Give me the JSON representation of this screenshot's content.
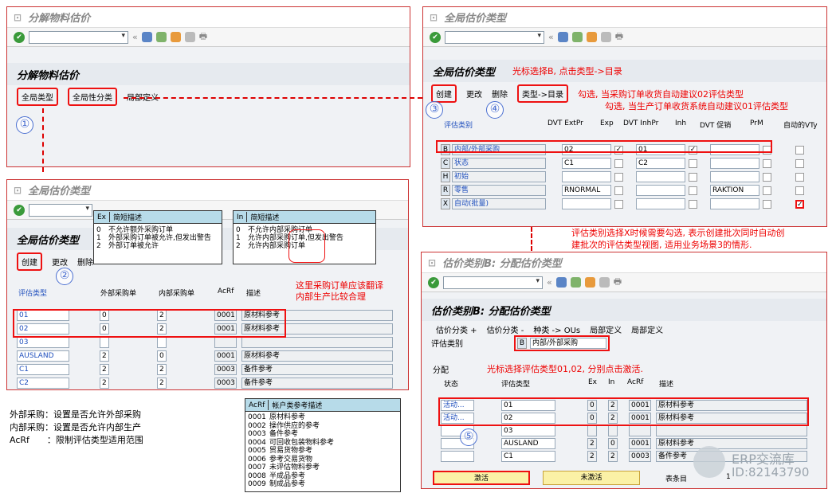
{
  "w1": {
    "title": "分解物料估价",
    "header": "分解物料估价",
    "btn1": "全局类型",
    "btn2": "全局性分类",
    "btn3": "局部定义",
    "n1": "①"
  },
  "w2": {
    "title": "全局估价类型",
    "header": "全局估价类型",
    "btns": [
      "创建",
      "更改",
      "删除"
    ],
    "n2": "②",
    "cols": {
      "vc": "评估类型",
      "ext": "外部采购单",
      "int": "内部采购单",
      "acrf": "AcRf",
      "desc": "描述"
    },
    "rows": [
      {
        "vc": "01",
        "ext": "0",
        "int": "2",
        "acrf": "0001",
        "desc": "原材料参考"
      },
      {
        "vc": "02",
        "ext": "0",
        "int": "2",
        "acrf": "0001",
        "desc": "原材料参考"
      },
      {
        "vc": "03",
        "ext": "",
        "int": "",
        "acrf": "",
        "desc": ""
      },
      {
        "vc": "AUSLAND",
        "ext": "2",
        "int": "0",
        "acrf": "0001",
        "desc": "原材料参考"
      },
      {
        "vc": "C1",
        "ext": "2",
        "int": "2",
        "acrf": "0003",
        "desc": "备件参考"
      },
      {
        "vc": "C2",
        "ext": "2",
        "int": "2",
        "acrf": "0003",
        "desc": "备件参考"
      }
    ],
    "note": "这里采购订单应该翻译\n内部生产比较合理"
  },
  "pop1": {
    "k": "Ex",
    "h": "简短描述",
    "rows": [
      [
        "0",
        "不允许额外采购订单"
      ],
      [
        "1",
        "外部采购订单被允许,但发出警告"
      ],
      [
        "2",
        "外部订单被允许"
      ]
    ]
  },
  "pop2": {
    "k": "In",
    "h": "简短描述",
    "rows": [
      [
        "0",
        "不允许内部采购订单"
      ],
      [
        "1",
        "允许内部采购订单,但发出警告"
      ],
      [
        "2",
        "允许内部采购订单"
      ]
    ]
  },
  "pop3": {
    "k": "AcRf",
    "h": "帐户类参考描述",
    "rows": [
      [
        "0001",
        "原材料参考"
      ],
      [
        "0002",
        "操作供应的参考"
      ],
      [
        "0003",
        "备件参考"
      ],
      [
        "0004",
        "可回收包装物料参考"
      ],
      [
        "0005",
        "贸易货物参考"
      ],
      [
        "0006",
        "参考交易货物"
      ],
      [
        "0007",
        "未评估物料参考"
      ],
      [
        "0008",
        "半成品参考"
      ],
      [
        "0009",
        "制成品参考"
      ]
    ]
  },
  "legend": [
    "外部采购：设置是否允许外部采购",
    "内部采购：设置是否允许内部生产",
    "AcRf　　：限制评估类型适用范围"
  ],
  "w3": {
    "title": "全局估价类型",
    "header": "全局估价类型",
    "hint": "光标选择B, 点击类型->目录",
    "btns": [
      "创建",
      "更改",
      "删除",
      "类型->目录"
    ],
    "n3": "③",
    "n4": "④",
    "note1": "勾选, 当采购订单收货自动建议02评估类型",
    "note2": "勾选, 当生产订单收货系统自动建议01评估类型",
    "cols": {
      "vc": "评估类别",
      "ext": "DVT ExtPr",
      "exp": "Exp",
      "inh": "DVT InhPr",
      "inhc": "Inh",
      "promo": "DVT 促销",
      "prm": "PrM",
      "auto": "自动的VTy"
    },
    "rows": [
      {
        "k": "B",
        "d": "内部/外部采购",
        "ext": "02",
        "exp": true,
        "inh": "01",
        "inhc": true,
        "promo": "",
        "auto": false
      },
      {
        "k": "C",
        "d": "状态",
        "ext": "C1",
        "exp": false,
        "inh": "C2",
        "inhc": false,
        "promo": "",
        "auto": false
      },
      {
        "k": "H",
        "d": "初始",
        "ext": "",
        "exp": false,
        "inh": "",
        "inhc": false,
        "promo": "",
        "auto": false
      },
      {
        "k": "R",
        "d": "零售",
        "ext": "RNORMAL",
        "exp": false,
        "inh": "",
        "inhc": false,
        "promo": "RAKTION",
        "auto": false
      },
      {
        "k": "X",
        "d": "自动(批量)",
        "ext": "",
        "exp": false,
        "inh": "",
        "inhc": false,
        "promo": "",
        "auto": true
      }
    ]
  },
  "note3": "评估类别选择X时候需要勾选, 表示创建批次同时自动创\n建批次的评估类型视图, 适用业务场景3的情形.",
  "w4": {
    "title": "估价类别B: 分配估价类型",
    "header": "估价类别B: 分配估价类型",
    "btns": [
      "估价分类 +",
      "估价分类 -",
      "种类 -> OUs",
      "局部定义",
      "局部定义"
    ],
    "catlbl": "评估类别",
    "catk": "B",
    "catd": "内部/外部采购",
    "grp": "分配",
    "hint": "光标选择评估类型01,02, 分别点击激活.",
    "cols": {
      "st": "状态",
      "vt": "评估类型",
      "ex": "Ex",
      "in": "In",
      "acrf": "AcRf",
      "desc": "描述"
    },
    "rows": [
      {
        "st": "活动...",
        "vt": "01",
        "ex": "0",
        "in": "2",
        "acrf": "0001",
        "desc": "原材料参考"
      },
      {
        "st": "活动...",
        "vt": "02",
        "ex": "0",
        "in": "2",
        "acrf": "0001",
        "desc": "原材料参考"
      },
      {
        "st": "",
        "vt": "03",
        "ex": "",
        "in": "",
        "acrf": "",
        "desc": ""
      },
      {
        "st": "",
        "vt": "AUSLAND",
        "ex": "2",
        "in": "0",
        "acrf": "0001",
        "desc": "原材料参考"
      },
      {
        "st": "",
        "vt": "C1",
        "ex": "2",
        "in": "2",
        "acrf": "0003",
        "desc": "备件参考"
      }
    ],
    "n5": "⑤",
    "act": "激活",
    "deact": "未激活",
    "entries": "表条目",
    "pg": "1",
    "wm1": "ERP交流库",
    "wm2": "ID:82143790"
  }
}
